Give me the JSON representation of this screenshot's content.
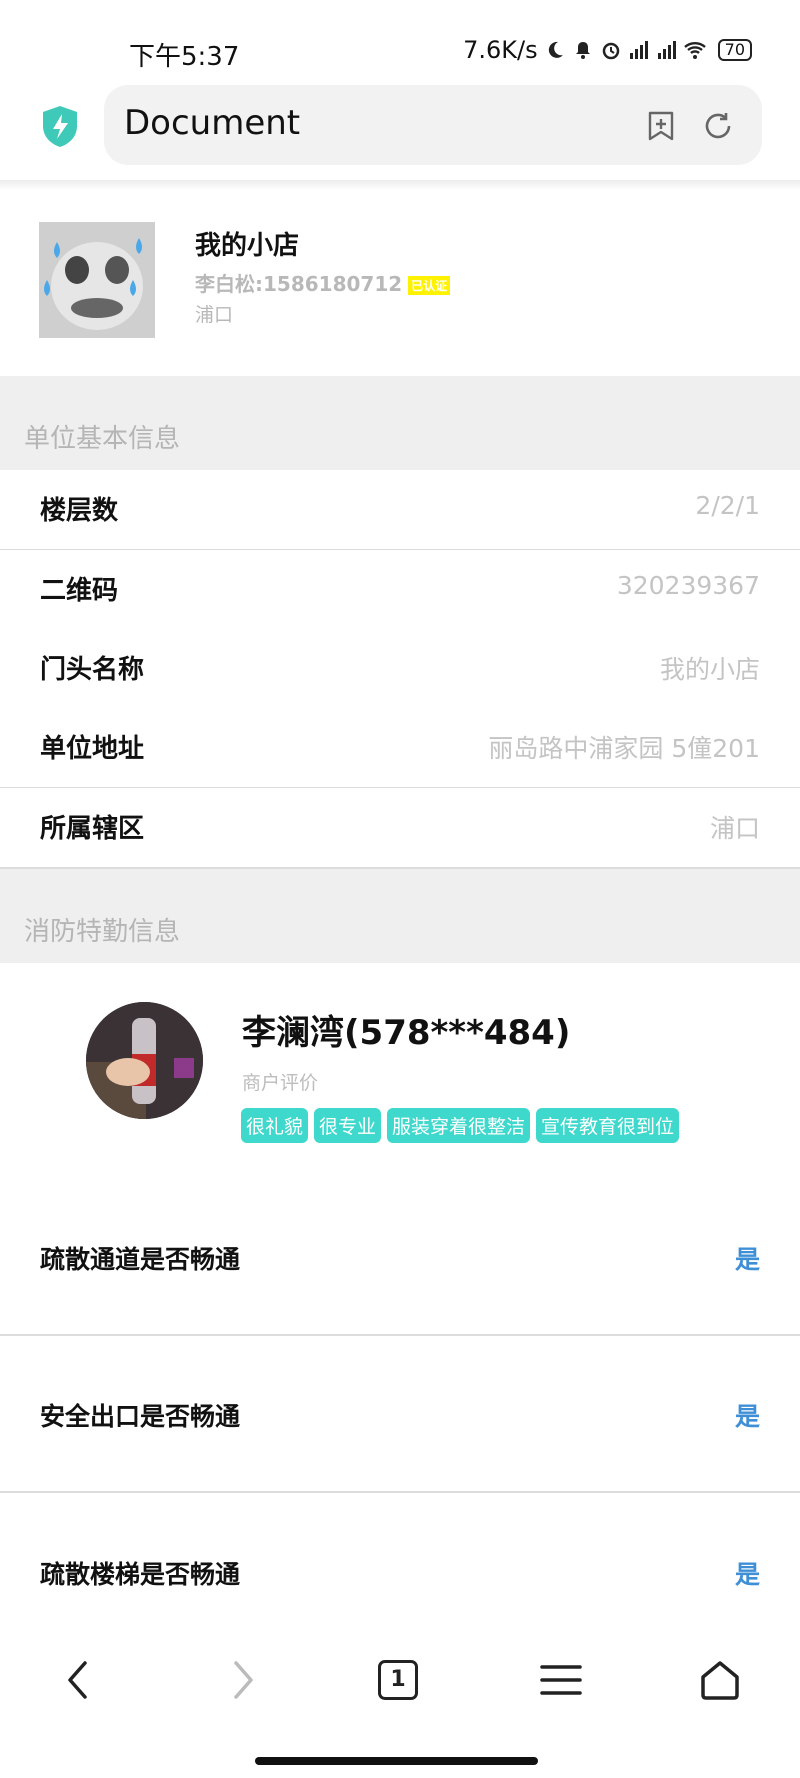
{
  "status_bar": {
    "time": "下午5:37",
    "net_speed": "7.6K/s",
    "battery": "70",
    "icons": [
      "moon-icon",
      "bell-mute-icon",
      "alarm-icon",
      "signal-icon",
      "signal-icon",
      "wifi-icon",
      "battery-icon"
    ]
  },
  "browser": {
    "title": "Document",
    "icons": [
      "shield-bolt-icon",
      "bookmark-add-icon",
      "reload-icon"
    ]
  },
  "shop": {
    "name": "我的小店",
    "owner": "李白松:1586180712",
    "verified_badge": "已认证",
    "area": "浦口"
  },
  "section_basic": {
    "title": "单位基本信息",
    "rows": [
      {
        "label": "楼层数",
        "value": "2/2/1"
      },
      {
        "label": "二维码",
        "value": "320239367"
      },
      {
        "label": "门头名称",
        "value": "我的小店"
      },
      {
        "label": "单位地址",
        "value": "丽岛路中浦家园 5僮201"
      },
      {
        "label": "所属辖区",
        "value": "浦口"
      }
    ]
  },
  "section_fire": {
    "title": "消防特勤信息",
    "inspector_name": "李澜湾(578***484)",
    "inspector_sub": "商户评价",
    "tags": [
      "很礼貌",
      "很专业",
      "服装穿着很整洁",
      "宣传教育很到位"
    ]
  },
  "checks": [
    {
      "label": "疏散通道是否畅通",
      "value": "是"
    },
    {
      "label": "安全出口是否畅通",
      "value": "是"
    },
    {
      "label": "疏散楼梯是否畅通",
      "value": "是"
    }
  ],
  "bottom_nav": {
    "tab_count": "1",
    "icons": [
      "back-icon",
      "forward-icon",
      "tabs-icon",
      "menu-icon",
      "home-icon"
    ]
  },
  "colors": {
    "accent_teal": "#3fd8cc",
    "link_blue": "#3f8fd6",
    "section_bg": "#efefef"
  }
}
